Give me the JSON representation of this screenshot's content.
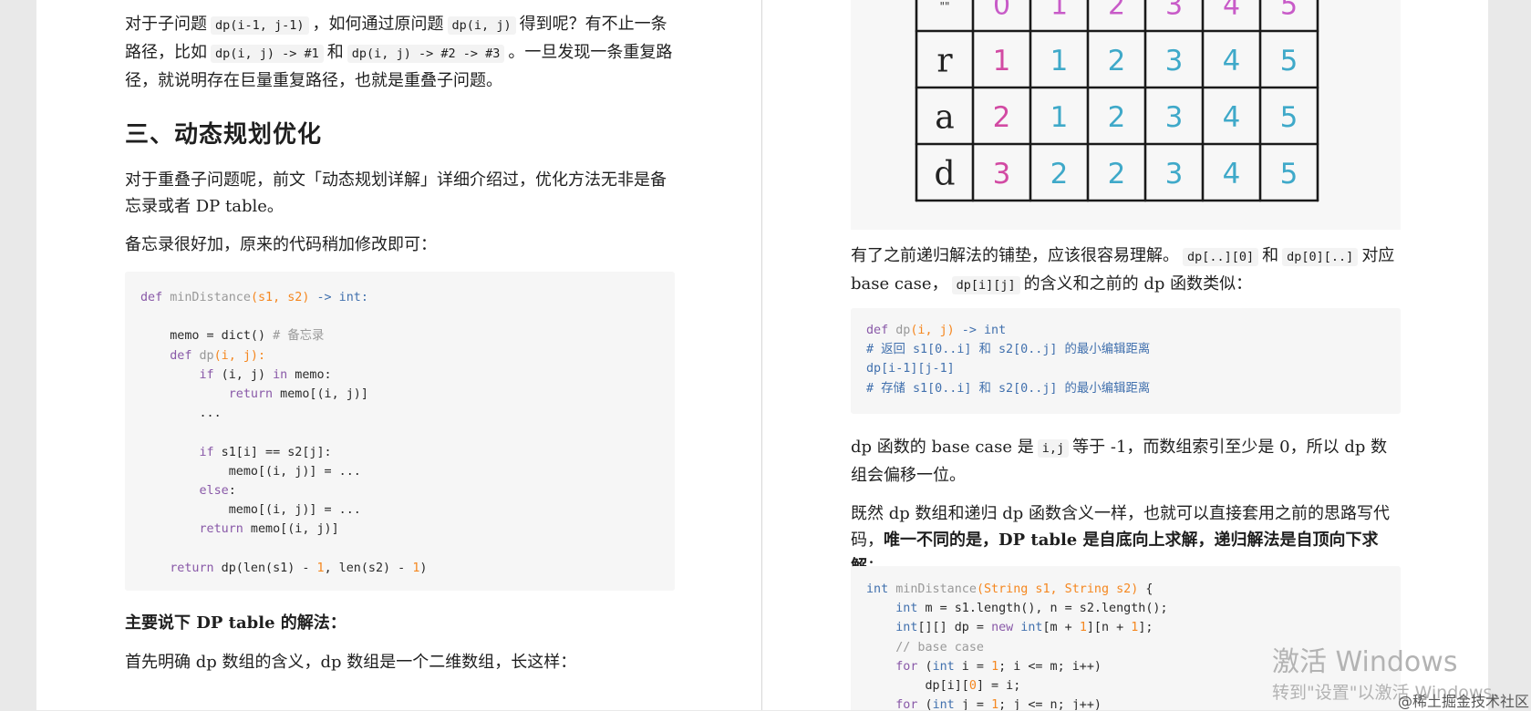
{
  "left": {
    "para1": {
      "t1": "对于子问题",
      "c1": "dp(i-1, j-1)",
      "t2": "，如何通过原问题",
      "c2": "dp(i, j)",
      "t3": "得到呢？有不止一条路径，比如",
      "c3": "dp(i, j) -> #1",
      "t4": "和",
      "c4": "dp(i, j) -> #2 -> #3",
      "t5": "。一旦发现一条重复路径，就说明存在巨量重复路径，也就是重叠子问题。"
    },
    "heading": "三、动态规划优化",
    "para2": "对于重叠子问题呢，前文「动态规划详解」详细介绍过，优化方法无非是备忘录或者 DP table。",
    "para3": "备忘录很好加，原来的代码稍加修改即可：",
    "code": {
      "l1_def": "def",
      "l1_name": "minDistance",
      "l1_params": "(s1, s2)",
      "l1_ret": " -> int:",
      "l3_text": "    memo = dict() ",
      "l3_comment": "# 备忘录",
      "l4_def": "def",
      "l4_name": "dp",
      "l4_params": "(i, j):",
      "l5_if": "if",
      "l5_a": " (i, j) ",
      "l5_in": "in",
      "l5_b": " memo:",
      "l6_ret": "return",
      "l6_b": " memo[(i, j)]",
      "l7": "...",
      "l9_if": "if",
      "l9_b": " s1[i] == s2[j]:",
      "l10": "memo[(i, j)] = ...",
      "l11_else": "else",
      "l11_b": ":",
      "l12": "memo[(i, j)] = ...",
      "l13_ret": "return",
      "l13_b": " memo[(i, j)]",
      "l15_ret": "return",
      "l15_a": " dp(len(s1) - ",
      "l15_n1": "1",
      "l15_b": ", len(s2) - ",
      "l15_n2": "1",
      "l15_c": ")"
    },
    "para4": "主要说下 DP table 的解法：",
    "para5": "首先明确 dp 数组的含义，dp 数组是一个二维数组，长这样："
  },
  "grid": {
    "corner": "\"\"",
    "row_labels": [
      "r",
      "a",
      "d"
    ],
    "header": [
      "0",
      "1",
      "2",
      "3",
      "4",
      "5"
    ],
    "rows": [
      [
        "1",
        "1",
        "2",
        "3",
        "4",
        "5"
      ],
      [
        "2",
        "1",
        "2",
        "3",
        "4",
        "5"
      ],
      [
        "3",
        "2",
        "2",
        "3",
        "4",
        "5"
      ]
    ]
  },
  "right": {
    "para1": {
      "t1": "有了之前递归解法的铺垫，应该很容易理解。",
      "c1": "dp[..][0]",
      "t2": "和",
      "c2": "dp[0][..]",
      "t3": "对应 base case，",
      "c3": "dp[i][j]",
      "t4": "的含义和之前的 dp 函数类似："
    },
    "code1": {
      "l1_def": "def",
      "l1_name": " dp",
      "l1_params": "(i, j)",
      "l1_ret": " -> int",
      "l2": "# 返回 s1[0..i] 和 s2[0..j] 的最小编辑距离",
      "l3": "dp[i-1][j-1]",
      "l4": "# 存储 s1[0..i] 和 s2[0..j] 的最小编辑距离"
    },
    "para2": {
      "t1": "dp 函数的 base case 是",
      "c1": "i,j",
      "t2": "等于 -1，而数组索引至少是 0，所以 dp 数组会偏移一位。"
    },
    "para3": {
      "t1": "既然 dp 数组和递归 dp 函数含义一样，也就可以直接套用之前的思路写代码，",
      "b1": "唯一不同的是，DP table 是自底向上求解，递归解法是自顶向下求解",
      "t2": "："
    },
    "code2": {
      "l1_int": "int",
      "l1_name": " minDistance",
      "l1_params": "(String s1, String s2)",
      "l1_b": " {",
      "l2_int": "int",
      "l2_b": " m = s1.length(), n = s2.length();",
      "l3_int": "int",
      "l3_a": "[][] dp = ",
      "l3_new": "new",
      "l3_int2": " int",
      "l3_b": "[m + ",
      "l3_n1": "1",
      "l3_c": "][n + ",
      "l3_n2": "1",
      "l3_d": "];",
      "l4": "// base case",
      "l5_for": "for",
      "l5_a": " (",
      "l5_int": "int",
      "l5_b": " i = ",
      "l5_n": "1",
      "l5_c": "; i <= m; i++)",
      "l6_a": "dp[i][",
      "l6_n": "0",
      "l6_b": "] = i;",
      "l7_for": "for",
      "l7_a": " (",
      "l7_int": "int",
      "l7_b": " j = ",
      "l7_n": "1",
      "l7_c": "; j <= n; j++)"
    }
  },
  "watermark": {
    "line1": "激活 Windows",
    "line2": "转到\"设置\"以激活 Windows。",
    "credit": "@稀土掘金技术社区"
  }
}
